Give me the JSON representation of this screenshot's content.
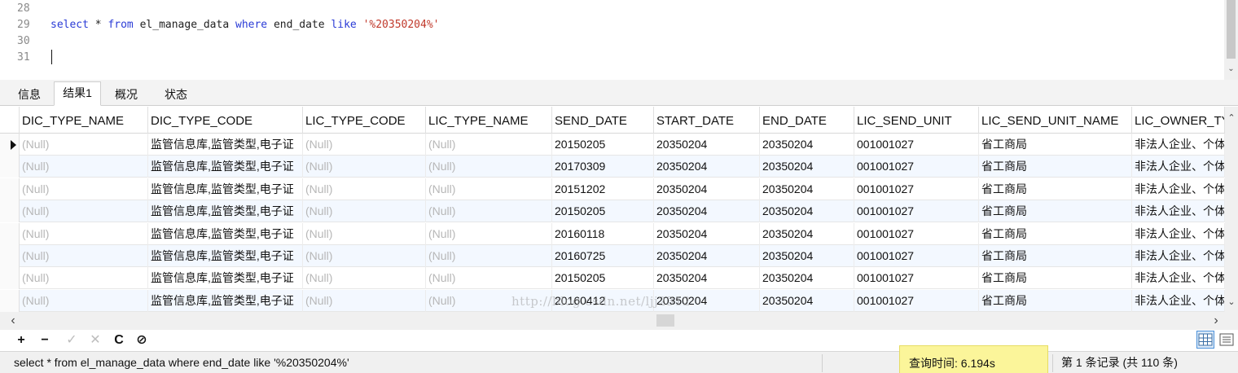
{
  "editor": {
    "lines": [
      {
        "num": "28",
        "tokens": []
      },
      {
        "num": "29",
        "tokens": [
          {
            "t": "select",
            "c": "kw"
          },
          {
            "t": " * ",
            "c": "pl"
          },
          {
            "t": "from",
            "c": "kw"
          },
          {
            "t": " el_manage_data ",
            "c": "pl"
          },
          {
            "t": "where",
            "c": "kw"
          },
          {
            "t": " end_date ",
            "c": "pl"
          },
          {
            "t": "like",
            "c": "kw"
          },
          {
            "t": " ",
            "c": "pl"
          },
          {
            "t": "'%20350204%'",
            "c": "str"
          }
        ]
      },
      {
        "num": "30",
        "tokens": []
      },
      {
        "num": "31",
        "tokens": []
      }
    ]
  },
  "tabs": [
    "信息",
    "结果1",
    "概况",
    "状态"
  ],
  "active_tab": "结果1",
  "grid": {
    "columns": [
      "DIC_TYPE_NAME",
      "DIC_TYPE_CODE",
      "LIC_TYPE_CODE",
      "LIC_TYPE_NAME",
      "SEND_DATE",
      "START_DATE",
      "END_DATE",
      "LIC_SEND_UNIT",
      "LIC_SEND_UNIT_NAME",
      "LIC_OWNER_TY"
    ],
    "rows": [
      [
        "(Null)",
        "监管信息库,监管类型,电子证",
        "(Null)",
        "(Null)",
        "20150205",
        "20350204",
        "20350204",
        "001001027",
        "省工商局",
        "非法人企业、个体"
      ],
      [
        "(Null)",
        "监管信息库,监管类型,电子证",
        "(Null)",
        "(Null)",
        "20170309",
        "20350204",
        "20350204",
        "001001027",
        "省工商局",
        "非法人企业、个体"
      ],
      [
        "(Null)",
        "监管信息库,监管类型,电子证",
        "(Null)",
        "(Null)",
        "20151202",
        "20350204",
        "20350204",
        "001001027",
        "省工商局",
        "非法人企业、个体"
      ],
      [
        "(Null)",
        "监管信息库,监管类型,电子证",
        "(Null)",
        "(Null)",
        "20150205",
        "20350204",
        "20350204",
        "001001027",
        "省工商局",
        "非法人企业、个体"
      ],
      [
        "(Null)",
        "监管信息库,监管类型,电子证",
        "(Null)",
        "(Null)",
        "20160118",
        "20350204",
        "20350204",
        "001001027",
        "省工商局",
        "非法人企业、个体"
      ],
      [
        "(Null)",
        "监管信息库,监管类型,电子证",
        "(Null)",
        "(Null)",
        "20160725",
        "20350204",
        "20350204",
        "001001027",
        "省工商局",
        "非法人企业、个体"
      ],
      [
        "(Null)",
        "监管信息库,监管类型,电子证",
        "(Null)",
        "(Null)",
        "20150205",
        "20350204",
        "20350204",
        "001001027",
        "省工商局",
        "非法人企业、个体"
      ],
      [
        "(Null)",
        "监管信息库,监管类型,电子证",
        "(Null)",
        "(Null)",
        "20160412",
        "20350204",
        "20350204",
        "001001027",
        "省工商局",
        "非法人企业、个体"
      ]
    ],
    "selected_row": 0,
    "watermark": "http://blog.csdn.net/ljj2312"
  },
  "toolbar": {
    "add": "+",
    "delete": "−",
    "apply": "✓",
    "cancel": "✕",
    "refresh": "C",
    "stop": "⊘"
  },
  "status": {
    "sql": "select * from el_manage_data where end_date like '%20350204%'",
    "query_time": "查询时间: 6.194s",
    "records": "第 1 条记录 (共 110 条)"
  },
  "colors": {
    "keyword": "#2a3bd6",
    "string": "#c0392b",
    "null": "#b7b7b7",
    "highlight": "#fbf59a"
  }
}
